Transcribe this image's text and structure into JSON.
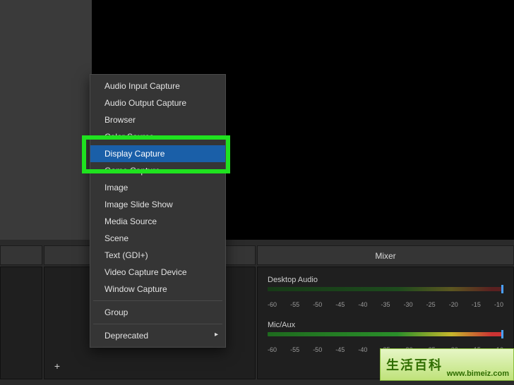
{
  "panels": {
    "mixer_title": "Mixer"
  },
  "context_menu": {
    "items": [
      "Audio Input Capture",
      "Audio Output Capture",
      "Browser",
      "Color Source",
      "Display Capture",
      "Game Capture",
      "Image",
      "Image Slide Show",
      "Media Source",
      "Scene",
      "Text (GDI+)",
      "Video Capture Device",
      "Window Capture"
    ],
    "group_label": "Group",
    "deprecated_label": "Deprecated",
    "selected_index": 4
  },
  "mixer": {
    "channels": [
      {
        "name": "Desktop Audio",
        "ticks": [
          "-60",
          "-55",
          "-50",
          "-45",
          "-40",
          "-35",
          "-30",
          "-25",
          "-20",
          "-15",
          "-10"
        ],
        "handle_pct": 100,
        "muted": true
      },
      {
        "name": "Mic/Aux",
        "ticks": [
          "-60",
          "-55",
          "-50",
          "-45",
          "-40",
          "-35",
          "-30",
          "-25",
          "-20",
          "-15",
          "-10"
        ],
        "handle_pct": 100,
        "muted": false
      }
    ]
  },
  "sources_toolbar": {
    "add_glyph": "+"
  },
  "watermark": {
    "chars": "生活百科",
    "url": "www.bimeiz.com"
  }
}
